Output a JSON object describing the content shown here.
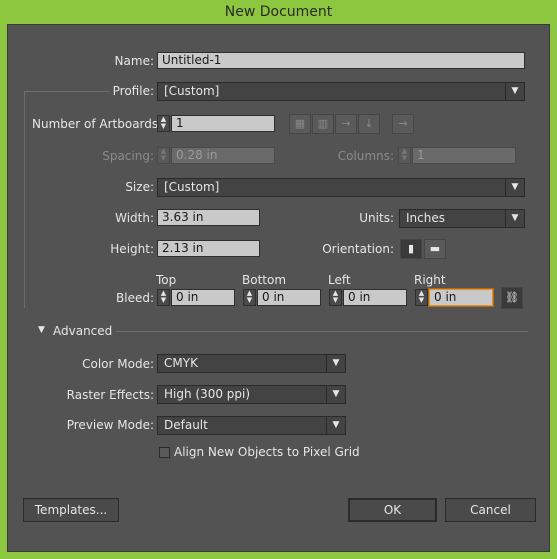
{
  "window": {
    "title": "New Document"
  },
  "name": {
    "label": "Name:",
    "value": "Untitled-1"
  },
  "profile": {
    "label": "Profile:",
    "value": "[Custom]"
  },
  "artboards": {
    "label": "Number of Artboards:",
    "value": "1"
  },
  "spacing": {
    "label": "Spacing:",
    "value": "0.28 in"
  },
  "columns": {
    "label": "Columns:",
    "value": "1"
  },
  "size": {
    "label": "Size:",
    "value": "[Custom]"
  },
  "width": {
    "label": "Width:",
    "value": "3.63 in"
  },
  "units": {
    "label": "Units:",
    "value": "Inches"
  },
  "height": {
    "label": "Height:",
    "value": "2.13 in"
  },
  "orientation": {
    "label": "Orientation:"
  },
  "bleed": {
    "label": "Bleed:",
    "top": {
      "label": "Top",
      "value": "0 in"
    },
    "bottom": {
      "label": "Bottom",
      "value": "0 in"
    },
    "left": {
      "label": "Left",
      "value": "0 in"
    },
    "right": {
      "label": "Right",
      "value": "0 in"
    }
  },
  "advanced": {
    "label": "Advanced",
    "color_mode": {
      "label": "Color Mode:",
      "value": "CMYK"
    },
    "raster_effects": {
      "label": "Raster Effects:",
      "value": "High (300 ppi)"
    },
    "preview_mode": {
      "label": "Preview Mode:",
      "value": "Default"
    },
    "align_pixel_grid": {
      "label": "Align New Objects to Pixel Grid",
      "checked": false
    }
  },
  "buttons": {
    "templates": "Templates...",
    "ok": "OK",
    "cancel": "Cancel"
  },
  "colors": {
    "frame": "#8dc63f",
    "dialog_bg": "#535353",
    "focus": "#e0922e"
  },
  "icons": [
    "grid-by-row-icon",
    "grid-by-column-icon",
    "arrange-by-row-icon",
    "arrange-by-column-icon",
    "right-to-left-icon",
    "portrait-icon",
    "landscape-icon",
    "link-icon",
    "triangle-down-icon"
  ]
}
